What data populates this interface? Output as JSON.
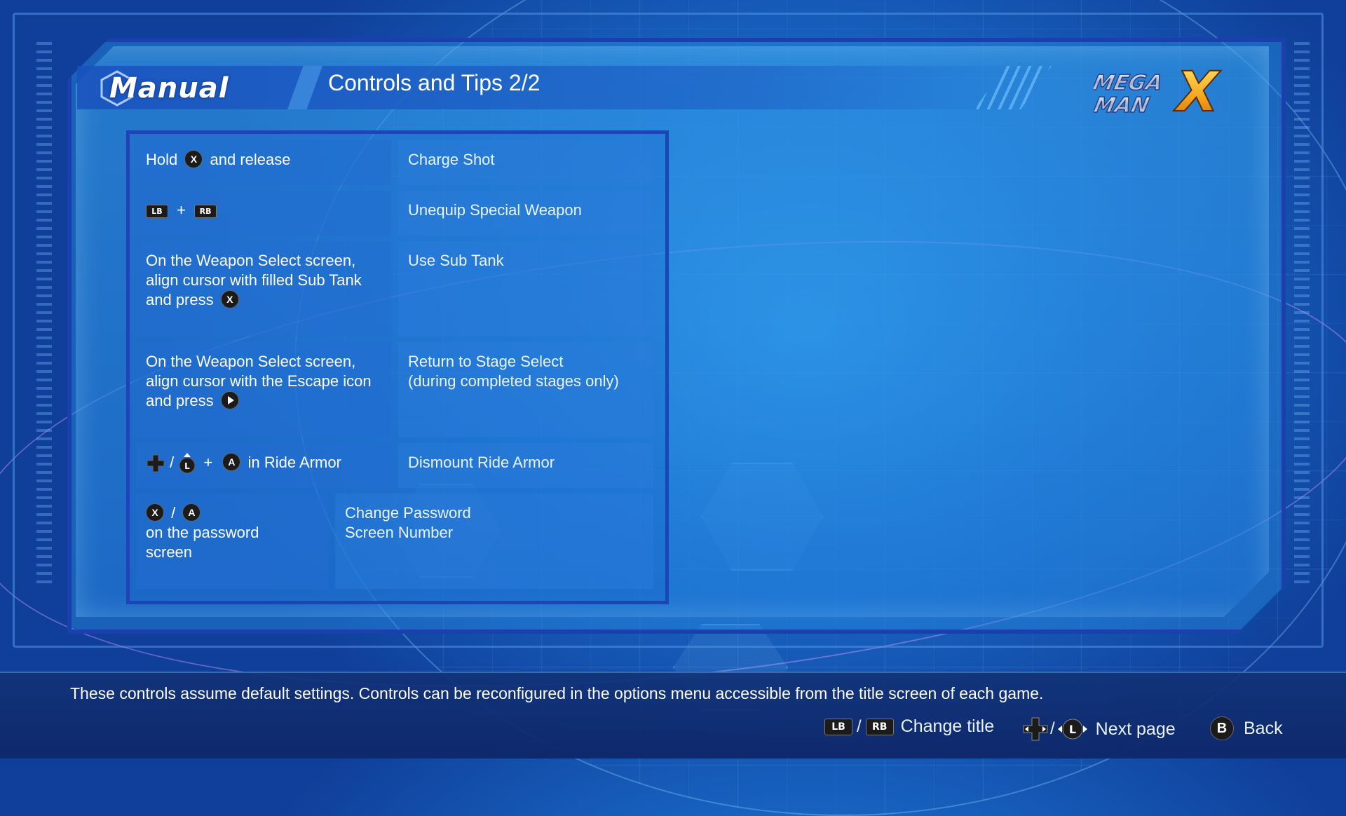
{
  "header": {
    "section_title": "Manual",
    "page_title": "Controls and Tips 2/2",
    "logo_alt": "MEGA MAN X"
  },
  "colors": {
    "panel_border": "#1c3fae",
    "cell_bg": "#236ed2",
    "bottom_bar": "#12327a",
    "button_bg": "#1b1b1b"
  },
  "controls": [
    {
      "input_parts": [
        "Hold",
        "X",
        "and release"
      ],
      "action": "Charge Shot"
    },
    {
      "input_parts": [
        "LB",
        "+",
        "RB"
      ],
      "action": "Unequip Special Weapon"
    },
    {
      "input_text": "On the Weapon Select screen, align cursor with filled Sub Tank and press",
      "input_button": "X",
      "action": "Use Sub Tank"
    },
    {
      "input_text": "On the Weapon Select screen, align cursor with the Escape icon and press",
      "input_button_icon": "play-icon",
      "action_line1": "Return to Stage Select",
      "action_line2": "(during completed stages only)"
    },
    {
      "input_parts": [
        "/",
        "L",
        "+",
        "A",
        "in Ride Armor"
      ],
      "input_icons": [
        "dpad-icon",
        "left-stick-icon"
      ],
      "action": "Dismount Ride Armor"
    },
    {
      "input_buttons": [
        "X",
        "/",
        "A"
      ],
      "input_line2": "on the password",
      "input_line3": "screen",
      "action_line1": "Change Password",
      "action_line2": "Screen Number"
    }
  ],
  "footer": {
    "notice": "These controls assume default settings. Controls can be reconfigured in the options menu accessible from the title screen of each game.",
    "legend": [
      {
        "keys": [
          "LB",
          "/",
          "RB"
        ],
        "label": "Change title"
      },
      {
        "keys": [
          "dpad-icon",
          "/",
          "left-stick-icon"
        ],
        "label": "Next page"
      },
      {
        "keys": [
          "B"
        ],
        "label": "Back"
      }
    ]
  }
}
